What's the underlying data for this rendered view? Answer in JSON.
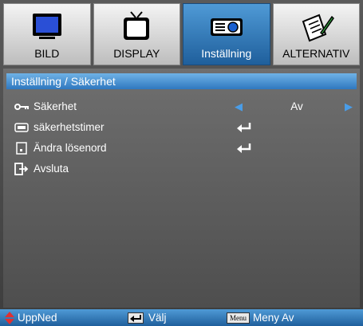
{
  "tabs": [
    {
      "label": "BILD",
      "icon": "monitor-icon",
      "active": false
    },
    {
      "label": "DISPLAY",
      "icon": "tv-icon",
      "active": false
    },
    {
      "label": "Inställning",
      "icon": "projector-icon",
      "active": true
    },
    {
      "label": "ALTERNATIV",
      "icon": "document-pen-icon",
      "active": false
    }
  ],
  "breadcrumb": "Inställning / Säkerhet",
  "menu": {
    "items": [
      {
        "label": "Säkerhet",
        "icon": "key-icon",
        "value": "Av"
      },
      {
        "label": "säkerhetstimer",
        "icon": "timer-icon"
      },
      {
        "label": "Ändra lösenord",
        "icon": "keypad-icon"
      },
      {
        "label": "Avsluta",
        "icon": "exit-icon"
      }
    ]
  },
  "footer": {
    "updown": "UppNed",
    "select": "Välj",
    "menu_key": "Menu",
    "menu_off": "Meny Av"
  },
  "colors": {
    "accent": "#2f78bf",
    "arrow": "#4a9de8"
  }
}
